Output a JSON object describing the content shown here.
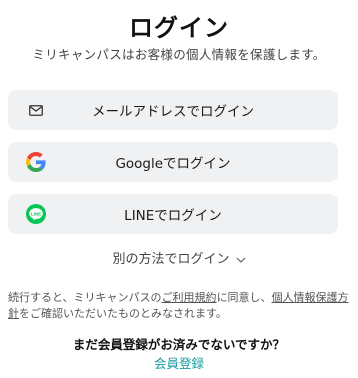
{
  "header": {
    "title": "ログイン",
    "subtitle": "ミリキャンパスはお客様の個人情報を保護します。"
  },
  "login_buttons": {
    "email": {
      "label": "メールアドレスでログイン",
      "icon": "mail-icon"
    },
    "google": {
      "label": "Googleでログイン",
      "icon": "google-icon"
    },
    "line": {
      "label": "LINEでログイン",
      "icon": "line-icon",
      "icon_text": "LINE",
      "color": "#06c755"
    }
  },
  "other_methods": {
    "label": "別の方法でログイン",
    "icon": "chevron-down-icon"
  },
  "terms": {
    "prefix": "続行すると、ミリキャンパスの",
    "terms_link": "ご利用規約",
    "middle": "に同意し、",
    "privacy_link": "個人情報保護方針",
    "suffix": "をご確認いただいたものとみなされます。"
  },
  "signup": {
    "question": "まだ会員登録がお済みでないですか？",
    "link": "会員登録",
    "link_color": "#1a9aa0"
  }
}
